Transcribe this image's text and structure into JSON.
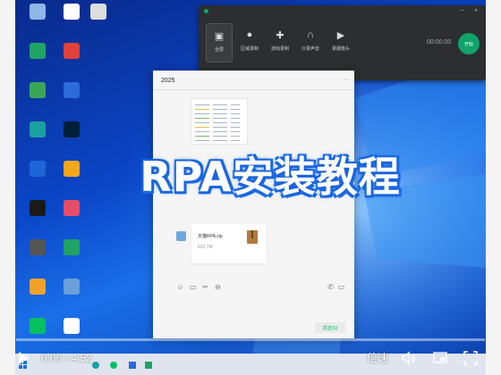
{
  "desktop": {
    "icons": [
      {
        "label": "",
        "icon": "recycle-bin-icon",
        "color": "#8fb6e8"
      },
      {
        "label": "",
        "icon": "doc-icon",
        "color": "#ffffff"
      },
      {
        "label": "",
        "icon": "file-icon",
        "color": "#dddddd"
      },
      {
        "label": "",
        "icon": "app-icon",
        "color": "#21a366"
      },
      {
        "label": "",
        "icon": "app-icon",
        "color": "#e0423a"
      },
      {
        "label": "",
        "icon": "app-icon",
        "color": "#3aa757"
      },
      {
        "label": "",
        "icon": "app-icon",
        "color": "#2b6cd8"
      },
      {
        "label": "",
        "icon": "edge-icon",
        "color": "#1ba0a0"
      },
      {
        "label": "",
        "icon": "photoshop-icon",
        "color": "#001e36"
      },
      {
        "label": "",
        "icon": "app-icon",
        "color": "#1e66d8"
      },
      {
        "label": "",
        "icon": "app-icon",
        "color": "#f4a61c"
      },
      {
        "label": "",
        "icon": "qq-icon",
        "color": "#1a1a1a"
      },
      {
        "label": "",
        "icon": "app-icon",
        "color": "#e54d6b"
      },
      {
        "label": "",
        "icon": "app-icon",
        "color": "#555555"
      },
      {
        "label": "",
        "icon": "excel-icon",
        "color": "#21a366"
      },
      {
        "label": "",
        "icon": "app-icon",
        "color": "#f2a22b"
      },
      {
        "label": "",
        "icon": "app-icon",
        "color": "#6a9fd8"
      },
      {
        "label": "",
        "icon": "wechat-icon",
        "color": "#07c160"
      },
      {
        "label": "",
        "icon": "file-icon",
        "color": "#ffffff"
      }
    ]
  },
  "recorder": {
    "tools": [
      {
        "label": "全屏",
        "icon": "fullscreen-icon"
      },
      {
        "label": "区域录制",
        "icon": "circle-icon"
      },
      {
        "label": "游戏录制",
        "icon": "gamepad-icon"
      },
      {
        "label": "只录声音",
        "icon": "headphones-icon"
      },
      {
        "label": "录摄像头",
        "icon": "play-icon"
      }
    ],
    "time": "00:00:00",
    "start_label": "开始",
    "status": "",
    "accent": "#10a36a"
  },
  "chat": {
    "title": "2025",
    "more": "···",
    "file": {
      "name": "天猫RPA.zip",
      "size": "631.7M"
    },
    "send_label": "发送(S)"
  },
  "overlay_title": "RPA安装教程",
  "player": {
    "current_time": "0:00",
    "duration": "4:52",
    "separator": " / ",
    "progress": 0.0,
    "speed_label": "倍速"
  }
}
